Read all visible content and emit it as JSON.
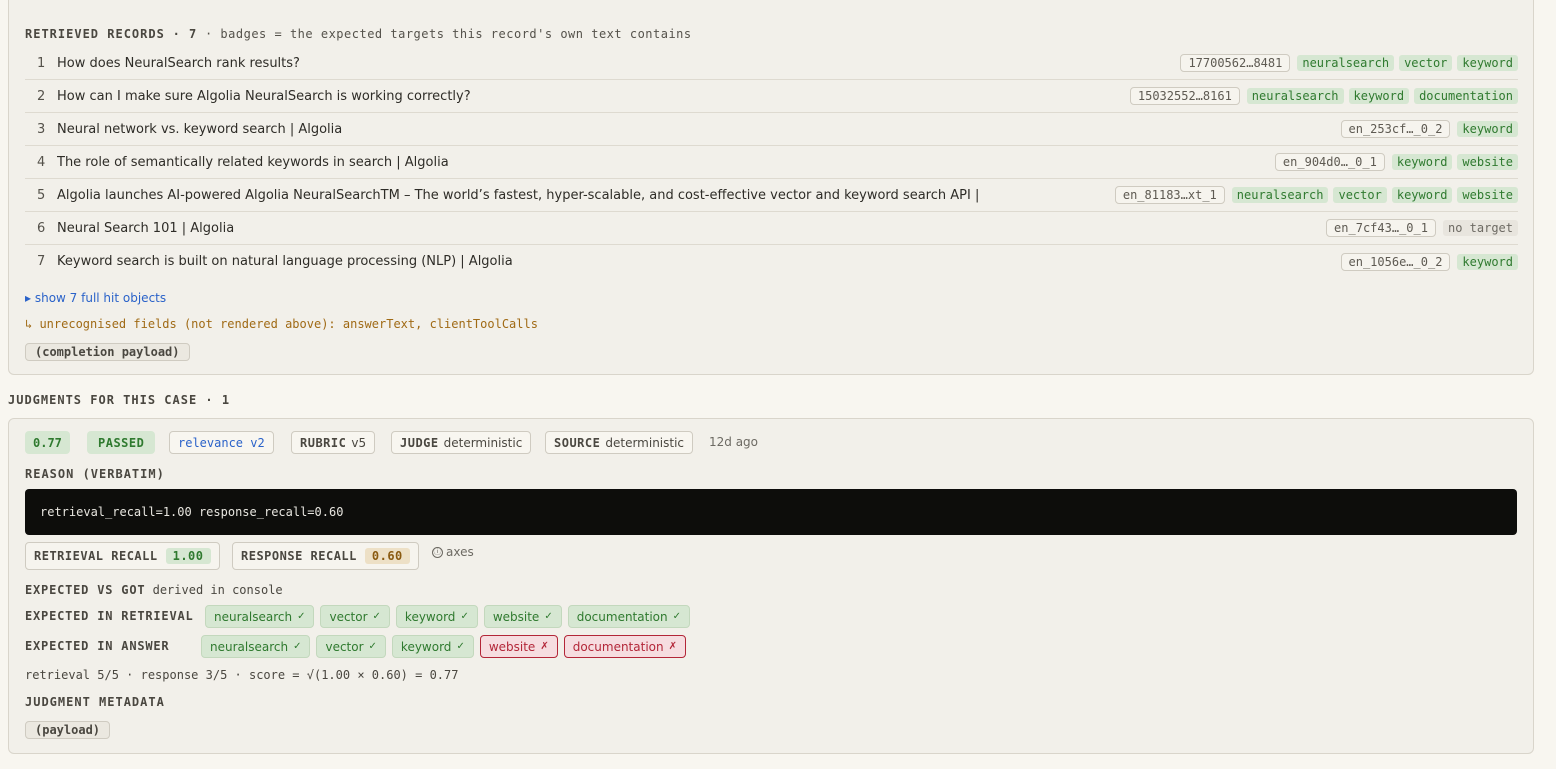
{
  "retrieved": {
    "heading": "RETRIEVED RECORDS",
    "count": "· 7",
    "note": "· badges = the expected targets this record's own text contains",
    "records": [
      {
        "n": "1",
        "title": "How does NeuralSearch rank results?",
        "id": "17700562…8481",
        "badges": [
          "neuralsearch",
          "vector",
          "keyword"
        ]
      },
      {
        "n": "2",
        "title": "How can I make sure Algolia NeuralSearch is working correctly?",
        "id": "15032552…8161",
        "badges": [
          "neuralsearch",
          "keyword",
          "documentation"
        ]
      },
      {
        "n": "3",
        "title": "Neural network vs. keyword search | Algolia",
        "id": "en_253cf…_0_2",
        "badges": [
          "keyword"
        ]
      },
      {
        "n": "4",
        "title": "The role of semantically related keywords in search | Algolia",
        "id": "en_904d0…_0_1",
        "badges": [
          "keyword",
          "website"
        ]
      },
      {
        "n": "5",
        "title": "Algolia launches AI-powered Algolia NeuralSearchTM – The world’s fastest, hyper-scalable, and cost-effective vector and keyword search API |",
        "id": "en_81183…xt_1",
        "badges": [
          "neuralsearch",
          "vector",
          "keyword",
          "website"
        ]
      },
      {
        "n": "6",
        "title": "Neural Search 101 | Algolia",
        "id": "en_7cf43…_0_1",
        "badges": [],
        "no_target": "no target"
      },
      {
        "n": "7",
        "title": "Keyword search is built on natural language processing (NLP) | Algolia",
        "id": "en_1056e…_0_2",
        "badges": [
          "keyword"
        ]
      }
    ],
    "show_hits_link": "▸ show 7 full hit objects",
    "unrecognised": "↳ unrecognised fields (not rendered above): answerText, clientToolCalls",
    "completion_payload": "(completion payload)"
  },
  "judgments": {
    "heading": "JUDGMENTS FOR THIS CASE · 1",
    "score": "0.77",
    "status": "PASSED",
    "metric": "relevance v2",
    "rubric_label": "RUBRIC",
    "rubric_value": "v5",
    "judge_label": "JUDGE",
    "judge_value": "deterministic",
    "source_label": "SOURCE",
    "source_value": "deterministic",
    "age": "12d ago",
    "reason_heading": "REASON (VERBATIM)",
    "reason_text": "retrieval_recall=1.00 response_recall=0.60",
    "retrieval_recall_label": "RETRIEVAL RECALL",
    "retrieval_recall_value": "1.00",
    "response_recall_label": "RESPONSE RECALL",
    "response_recall_value": "0.60",
    "axes_icon": "ⓘ",
    "axes_label": "axes",
    "expected_vs_got_label": "EXPECTED VS GOT",
    "expected_vs_got_note": "derived in console",
    "expected_in_retrieval_label": "EXPECTED IN RETRIEVAL",
    "expected_in_retrieval": [
      {
        "label": "neuralsearch",
        "mark": "✓",
        "ok": true
      },
      {
        "label": "vector",
        "mark": "✓",
        "ok": true
      },
      {
        "label": "keyword",
        "mark": "✓",
        "ok": true
      },
      {
        "label": "website",
        "mark": "✓",
        "ok": true
      },
      {
        "label": "documentation",
        "mark": "✓",
        "ok": true
      }
    ],
    "expected_in_answer_label": "EXPECTED IN ANSWER",
    "expected_in_answer": [
      {
        "label": "neuralsearch",
        "mark": "✓",
        "ok": true
      },
      {
        "label": "vector",
        "mark": "✓",
        "ok": true
      },
      {
        "label": "keyword",
        "mark": "✓",
        "ok": true
      },
      {
        "label": "website",
        "mark": "✗",
        "ok": false
      },
      {
        "label": "documentation",
        "mark": "✗",
        "ok": false
      }
    ],
    "formula": "retrieval 5/5 · response 3/5 · score = √(1.00 × 0.60) = 0.77",
    "metadata_heading": "JUDGMENT METADATA",
    "payload_button": "(payload)"
  }
}
